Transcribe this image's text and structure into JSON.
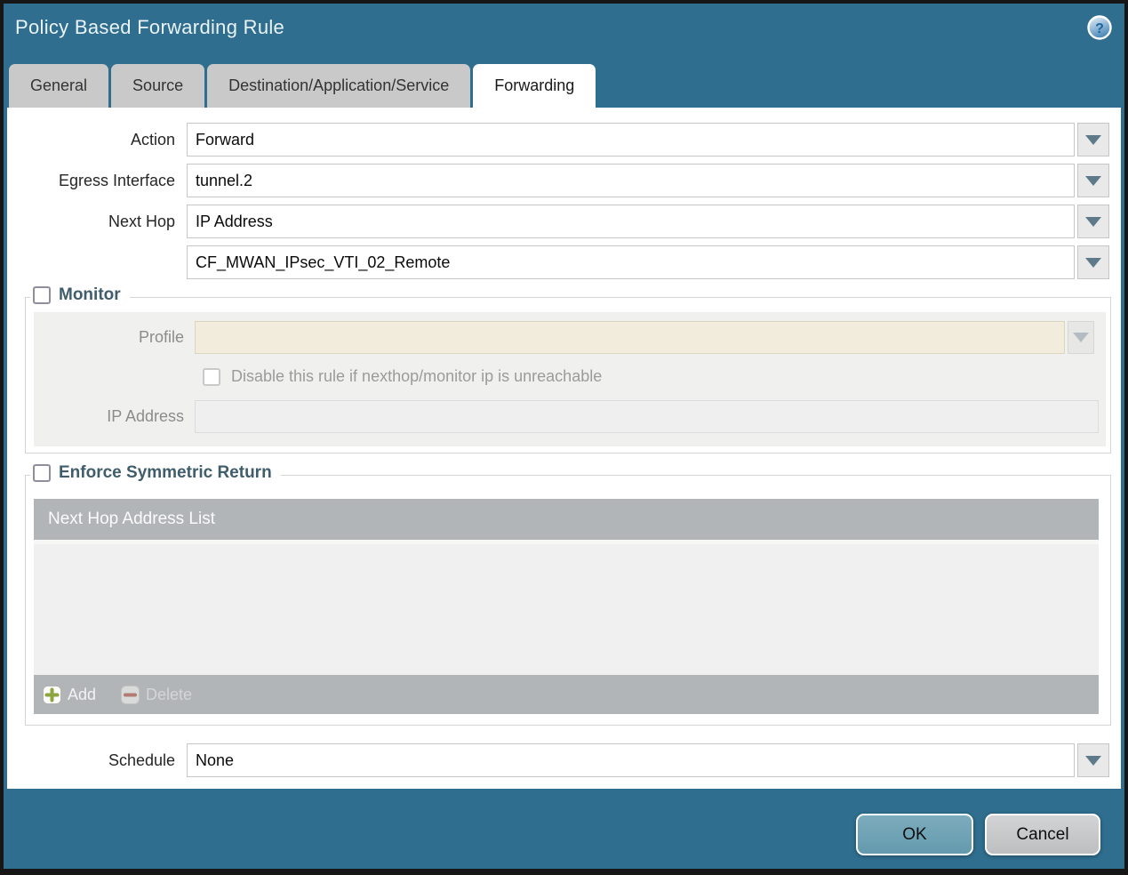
{
  "window": {
    "title": "Policy Based Forwarding Rule",
    "help_glyph": "?"
  },
  "tabs": [
    {
      "label": "General",
      "active": false
    },
    {
      "label": "Source",
      "active": false
    },
    {
      "label": "Destination/Application/Service",
      "active": false
    },
    {
      "label": "Forwarding",
      "active": true
    }
  ],
  "fields": {
    "action": {
      "label": "Action",
      "value": "Forward"
    },
    "egress_interface": {
      "label": "Egress Interface",
      "value": "tunnel.2"
    },
    "next_hop": {
      "label": "Next Hop",
      "value": "IP Address"
    },
    "next_hop_address": {
      "value": "CF_MWAN_IPsec_VTI_02_Remote"
    },
    "schedule": {
      "label": "Schedule",
      "value": "None"
    }
  },
  "monitor": {
    "legend": "Monitor",
    "checked": false,
    "profile": {
      "label": "Profile",
      "value": ""
    },
    "disable_rule": {
      "label": "Disable this rule if nexthop/monitor ip is unreachable",
      "checked": false
    },
    "ip_address": {
      "label": "IP Address",
      "value": ""
    }
  },
  "enforce_symmetric_return": {
    "legend": "Enforce Symmetric Return",
    "checked": false,
    "table": {
      "header": "Next Hop Address List",
      "rows": []
    },
    "add_label": "Add",
    "delete_label": "Delete"
  },
  "buttons": {
    "ok": "OK",
    "cancel": "Cancel"
  },
  "colors": {
    "titlebar_teal": "#2F6E8E",
    "tab_inactive": "#C9C9C9",
    "section_legend": "#3F5D6B",
    "disabled_field_beige": "#F1ECDB",
    "table_chrome": "#B2B5B7",
    "ok_button": "#6FA3B6",
    "cancel_button": "#C7C9CB",
    "add_icon_green": "#8CA53E",
    "delete_icon_red": "#A65C52",
    "dropdown_arrow": "#5E7A8A"
  }
}
